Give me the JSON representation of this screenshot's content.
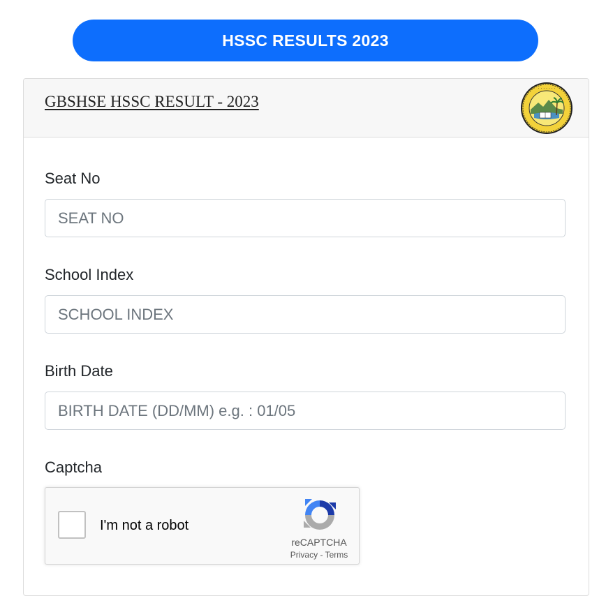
{
  "banner": {
    "label": "HSSC RESULTS 2023",
    "color": "#0d6efd"
  },
  "card": {
    "title": "GBSHSE HSSC RESULT - 2023",
    "seal_icon": "board-seal-icon"
  },
  "form": {
    "seat_no": {
      "label": "Seat No",
      "placeholder": "SEAT NO",
      "value": ""
    },
    "school_index": {
      "label": "School Index",
      "placeholder": "SCHOOL INDEX",
      "value": ""
    },
    "birth_date": {
      "label": "Birth Date",
      "placeholder": "BIRTH DATE (DD/MM) e.g. : 01/05",
      "value": ""
    },
    "captcha": {
      "label": "Captcha",
      "checkbox_text": "I'm not a robot",
      "brand": "reCAPTCHA",
      "privacy": "Privacy",
      "separator": " - ",
      "terms": "Terms",
      "logo_icon": "recaptcha-logo-icon"
    }
  }
}
